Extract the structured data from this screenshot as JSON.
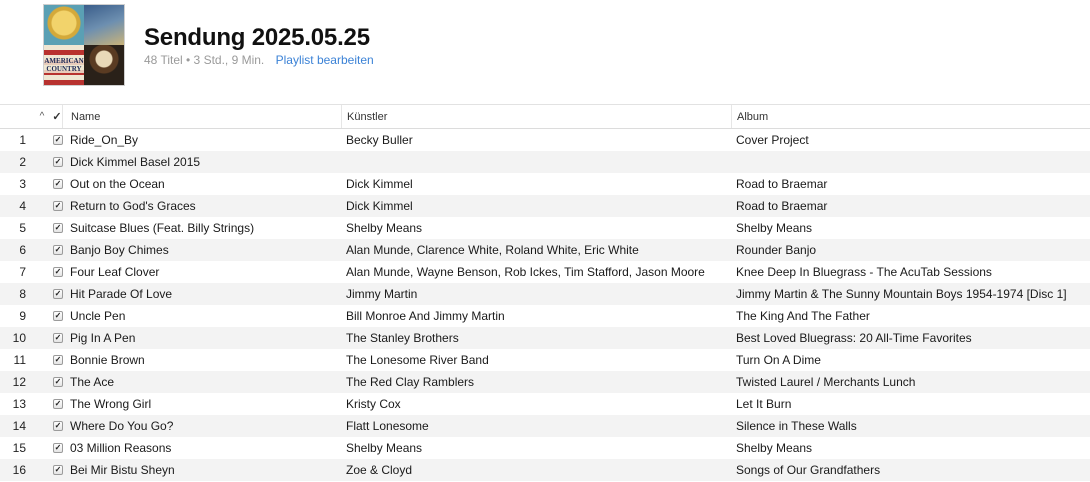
{
  "playlist": {
    "title": "Sendung 2025.05.25",
    "meta": "48 Titel • 3 Std., 9 Min.",
    "edit_label": "Playlist bearbeiten",
    "artwork_text": "AMERICAN COUNTRY"
  },
  "columns": {
    "sort_indicator": "^",
    "check_header": "✓",
    "name": "Name",
    "artist": "Künstler",
    "album": "Album"
  },
  "colors": {
    "link": "#3b82d6",
    "alt_row": "#f3f3f3"
  },
  "tracks": [
    {
      "num": "1",
      "checked": "✓",
      "name": "Ride_On_By",
      "artist": "Becky Buller",
      "album": "Cover Project"
    },
    {
      "num": "2",
      "checked": "✓",
      "name": "Dick Kimmel Basel 2015",
      "artist": "",
      "album": ""
    },
    {
      "num": "3",
      "checked": "✓",
      "name": "Out on the Ocean",
      "artist": "Dick Kimmel",
      "album": "Road to Braemar"
    },
    {
      "num": "4",
      "checked": "✓",
      "name": "Return to God's Graces",
      "artist": "Dick Kimmel",
      "album": "Road to Braemar"
    },
    {
      "num": "5",
      "checked": "✓",
      "name": "Suitcase Blues (Feat. Billy Strings)",
      "artist": "Shelby Means",
      "album": "Shelby Means"
    },
    {
      "num": "6",
      "checked": "✓",
      "name": "Banjo Boy Chimes",
      "artist": "Alan Munde, Clarence White, Roland White, Eric White",
      "album": "Rounder Banjo"
    },
    {
      "num": "7",
      "checked": "✓",
      "name": "Four Leaf Clover",
      "artist": "Alan Munde, Wayne Benson, Rob Ickes, Tim Stafford, Jason Moore",
      "album": "Knee Deep In Bluegrass - The AcuTab Sessions"
    },
    {
      "num": "8",
      "checked": "✓",
      "name": "Hit Parade Of Love",
      "artist": "Jimmy Martin",
      "album": "Jimmy Martin & The Sunny Mountain Boys 1954-1974 [Disc 1]"
    },
    {
      "num": "9",
      "checked": "✓",
      "name": "Uncle Pen",
      "artist": "Bill Monroe And Jimmy Martin",
      "album": "The King And The Father"
    },
    {
      "num": "10",
      "checked": "✓",
      "name": "Pig In A Pen",
      "artist": "The Stanley Brothers",
      "album": "Best Loved Bluegrass: 20 All-Time Favorites"
    },
    {
      "num": "11",
      "checked": "✓",
      "name": "Bonnie Brown",
      "artist": "The Lonesome River Band",
      "album": "Turn On A Dime"
    },
    {
      "num": "12",
      "checked": "✓",
      "name": "The Ace",
      "artist": "The Red Clay Ramblers",
      "album": "Twisted Laurel / Merchants Lunch"
    },
    {
      "num": "13",
      "checked": "✓",
      "name": "The Wrong Girl",
      "artist": "Kristy Cox",
      "album": "Let It Burn"
    },
    {
      "num": "14",
      "checked": "✓",
      "name": "Where Do You Go?",
      "artist": "Flatt Lonesome",
      "album": "Silence in These Walls"
    },
    {
      "num": "15",
      "checked": "✓",
      "name": "03 Million Reasons",
      "artist": "Shelby Means",
      "album": "Shelby Means"
    },
    {
      "num": "16",
      "checked": "✓",
      "name": "Bei Mir Bistu Sheyn",
      "artist": "Zoe & Cloyd",
      "album": "Songs of Our Grandfathers"
    }
  ]
}
